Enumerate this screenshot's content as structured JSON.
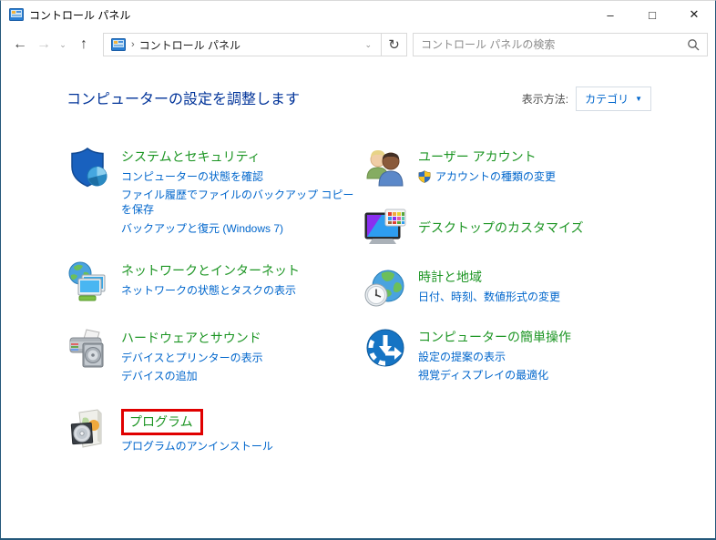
{
  "window": {
    "title": "コントロール パネル",
    "controls": {
      "minimize": "–",
      "maximize": "□",
      "close": "✕"
    }
  },
  "navbar": {
    "back": "←",
    "forward": "→",
    "up": "↑",
    "dropdown": "⌄",
    "refresh": "↻",
    "breadcrumb": {
      "separator": "›",
      "root_label": "コントロール パネル"
    },
    "search": {
      "placeholder": "コントロール パネルの検索"
    }
  },
  "header": {
    "title": "コンピューターの設定を調整します",
    "view_by_label": "表示方法:",
    "view_by_value": "カテゴリ",
    "view_by_arrow": "▼"
  },
  "categories": {
    "left": [
      {
        "title": "システムとセキュリティ",
        "links": [
          "コンピューターの状態を確認",
          "ファイル履歴でファイルのバックアップ コピーを保存",
          "バックアップと復元 (Windows 7)"
        ]
      },
      {
        "title": "ネットワークとインターネット",
        "links": [
          "ネットワークの状態とタスクの表示"
        ]
      },
      {
        "title": "ハードウェアとサウンド",
        "links": [
          "デバイスとプリンターの表示",
          "デバイスの追加"
        ]
      },
      {
        "title": "プログラム",
        "highlighted": true,
        "links": [
          "プログラムのアンインストール"
        ]
      }
    ],
    "right": [
      {
        "title": "ユーザー アカウント",
        "links": [
          "アカウントの種類の変更"
        ],
        "uac_shield": true
      },
      {
        "title": "デスクトップのカスタマイズ",
        "links": []
      },
      {
        "title": "時計と地域",
        "links": [
          "日付、時刻、数値形式の変更"
        ]
      },
      {
        "title": "コンピューターの簡単操作",
        "links": [
          "設定の提案の表示",
          "視覚ディスプレイの最適化"
        ]
      }
    ]
  },
  "colors": {
    "category_title_green": "#1c9523",
    "task_link_blue": "#0066cc",
    "page_title_blue": "#003399",
    "highlight_red": "#e00000",
    "window_border": "#24587a"
  }
}
